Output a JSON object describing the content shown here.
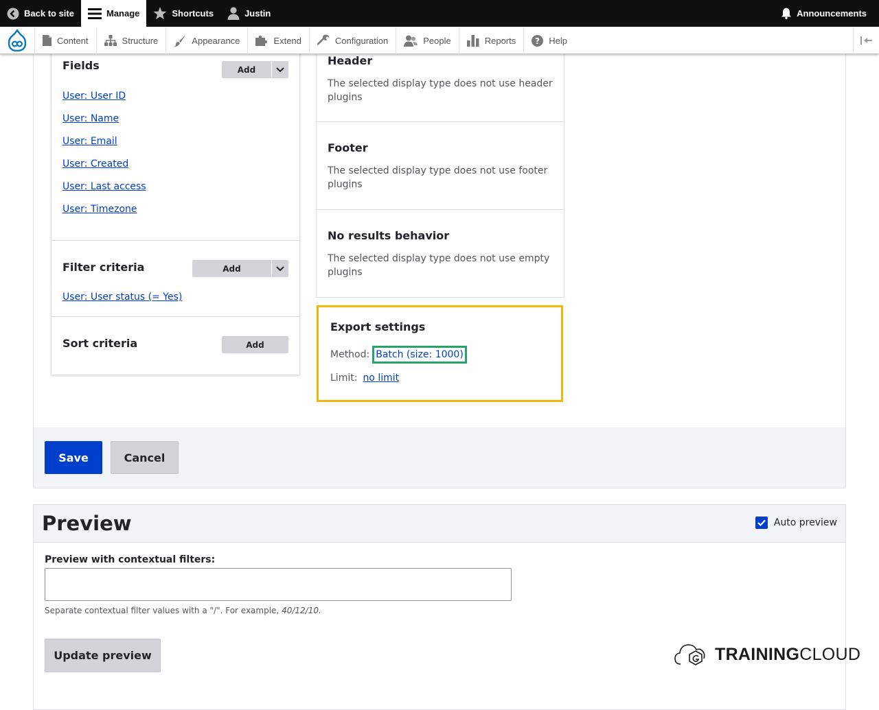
{
  "toolbar": {
    "back": "Back to site",
    "manage": "Manage",
    "shortcuts": "Shortcuts",
    "user": "Justin",
    "announcements": "Announcements"
  },
  "tray": {
    "items": [
      "Content",
      "Structure",
      "Appearance",
      "Extend",
      "Configuration",
      "People",
      "Reports",
      "Help"
    ]
  },
  "fields": {
    "title": "Fields",
    "add": "Add",
    "items": [
      "User: User ID",
      "User: Name",
      "User: Email",
      "User: Created",
      "User: Last access",
      "User: Timezone"
    ]
  },
  "filter": {
    "title": "Filter criteria",
    "add": "Add",
    "items": [
      "User: User status (= Yes)"
    ]
  },
  "sort": {
    "title": "Sort criteria",
    "add": "Add"
  },
  "header": {
    "title": "Header",
    "text": "The selected display type does not use header plugins"
  },
  "footer": {
    "title": "Footer",
    "text": "The selected display type does not use footer plugins"
  },
  "noresults": {
    "title": "No results behavior",
    "text": "The selected display type does not use empty plugins"
  },
  "export": {
    "title": "Export settings",
    "method_label": "Method:",
    "method_value": "Batch (size: 1000)",
    "limit_label": "Limit:",
    "limit_value": "no limit"
  },
  "actions": {
    "save": "Save",
    "cancel": "Cancel"
  },
  "preview": {
    "title": "Preview",
    "auto_preview": "Auto preview",
    "auto_preview_checked": true,
    "ctx_label": "Preview with contextual filters:",
    "ctx_value": "",
    "ctx_desc": "Separate contextual filter values with a \"/\". For example, ",
    "ctx_example": "40/12/10.",
    "update": "Update preview"
  },
  "branding": {
    "bold": "TRAINING",
    "regular": "CLOUD"
  },
  "colors": {
    "primary": "#003ecc",
    "highlight_yellow": "#f0b70a",
    "highlight_green": "#25a36b",
    "toolbar_bg": "#0f0f0f"
  }
}
